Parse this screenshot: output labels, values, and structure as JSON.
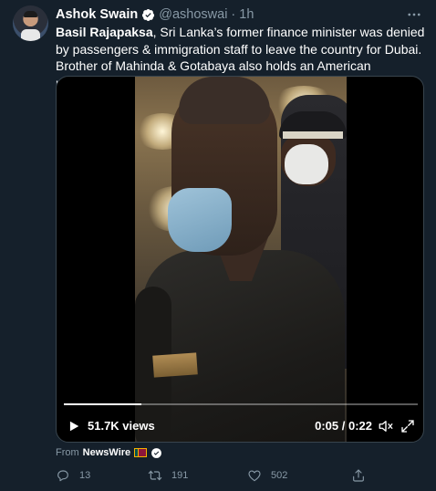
{
  "author": {
    "name": "Ashok Swain",
    "handle": "@ashoswai",
    "separator": "·",
    "time": "1h"
  },
  "tweet": {
    "bold_lead": "Basil Rajapaksa",
    "body": ", Sri Lanka’s former finance minister was denied by passengers & immigration staff to leave the country for Dubai. Brother of Mahinda & Gotabaya also holds an American passport."
  },
  "video": {
    "views": "51.7K views",
    "timecode": "0:05 / 0:22",
    "progress_fraction": 0.22
  },
  "source": {
    "prefix": "From",
    "app": "NewsWire"
  },
  "actions": {
    "replies": "13",
    "retweets": "191",
    "likes": "502"
  },
  "colors": {
    "background": "#15202b",
    "muted": "#8899a6",
    "verified": "#ffffff"
  },
  "icons": {
    "verified": "verified-badge-icon",
    "more": "more-horizontal-icon",
    "play": "play-icon",
    "volume": "volume-icon",
    "fullscreen": "fullscreen-icon",
    "reply": "reply-icon",
    "retweet": "retweet-icon",
    "like": "heart-icon",
    "share": "share-icon"
  }
}
